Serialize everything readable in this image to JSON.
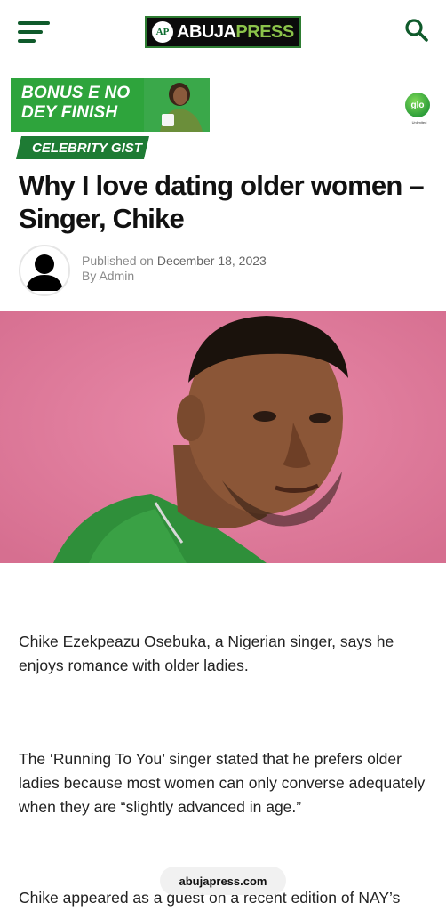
{
  "header": {
    "menu_icon": "hamburger-icon",
    "logo_badge": "AP",
    "logo_part1": "ABUJA",
    "logo_part2": "PRESS",
    "search_icon": "search-icon",
    "brand_color": "#0f5a2b"
  },
  "ad": {
    "line1": "BONUS E NO",
    "line2": "DEY FINISH",
    "brand": "glo",
    "tagline": "Unlimited",
    "color": "#2ea43c"
  },
  "article": {
    "category": "CELEBRITY GIST",
    "title": "Why I love dating older women – Singer, Chike",
    "published_prefix": "Published on",
    "published_date": "December 18, 2023",
    "author": "By Admin",
    "paragraphs": [
      "Chike Ezekpeazu Osebuka, a Nigerian singer, says he enjoys romance with older ladies.",
      "The ‘Running To You’ singer stated that he prefers older ladies because most women can only converse adequately when they are “slightly advanced in age.”",
      "Chike appeared as a guest on a recent edition of NAY’s"
    ]
  },
  "browser": {
    "url": "abujapress.com"
  }
}
